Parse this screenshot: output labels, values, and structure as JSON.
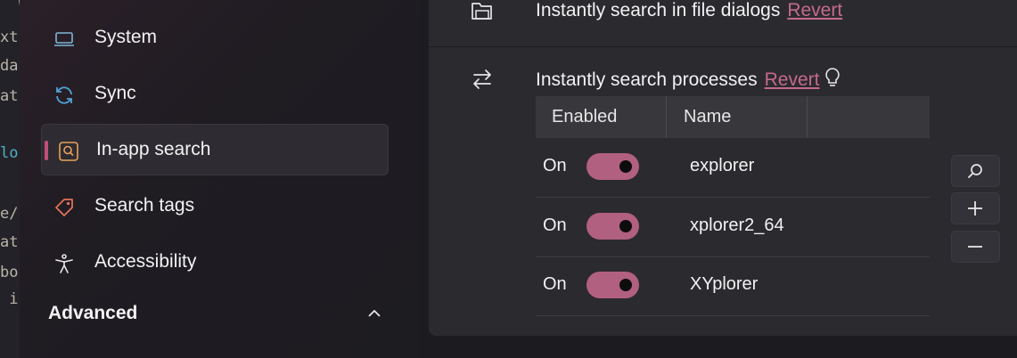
{
  "code_fragment": [
    "  W",
    "xt",
    "da",
    "at",
    "lo",
    "e/",
    "at",
    "bo",
    " i"
  ],
  "sidebar": {
    "items": [
      {
        "label": "System",
        "icon": "laptop-icon"
      },
      {
        "label": "Sync",
        "icon": "sync-icon"
      },
      {
        "label": "In-app search",
        "icon": "search-box-icon",
        "active": true
      },
      {
        "label": "Search tags",
        "icon": "tag-icon"
      },
      {
        "label": "Accessibility",
        "icon": "accessibility-icon"
      }
    ],
    "section_label": "Advanced"
  },
  "settings": {
    "file_dialogs": {
      "label": "Instantly search in file dialogs",
      "revert": "Revert"
    },
    "processes": {
      "label": "Instantly search processes",
      "revert": "Revert"
    }
  },
  "table": {
    "headers": [
      "Enabled",
      "Name"
    ],
    "rows": [
      {
        "state": "On",
        "enabled": true,
        "name": "explorer"
      },
      {
        "state": "On",
        "enabled": true,
        "name": "xplorer2_64"
      },
      {
        "state": "On",
        "enabled": true,
        "name": "XYplorer"
      }
    ]
  },
  "actions": [
    "search-icon",
    "plus-icon",
    "minus-icon"
  ],
  "colors": {
    "accent": "#c24f7a",
    "toggle_on": "#b2607f",
    "revert_link": "#c46a8a",
    "sync_icon": "#4fa3d9",
    "tag_icon": "#e8735a",
    "search_icon": "#e8a15a"
  }
}
